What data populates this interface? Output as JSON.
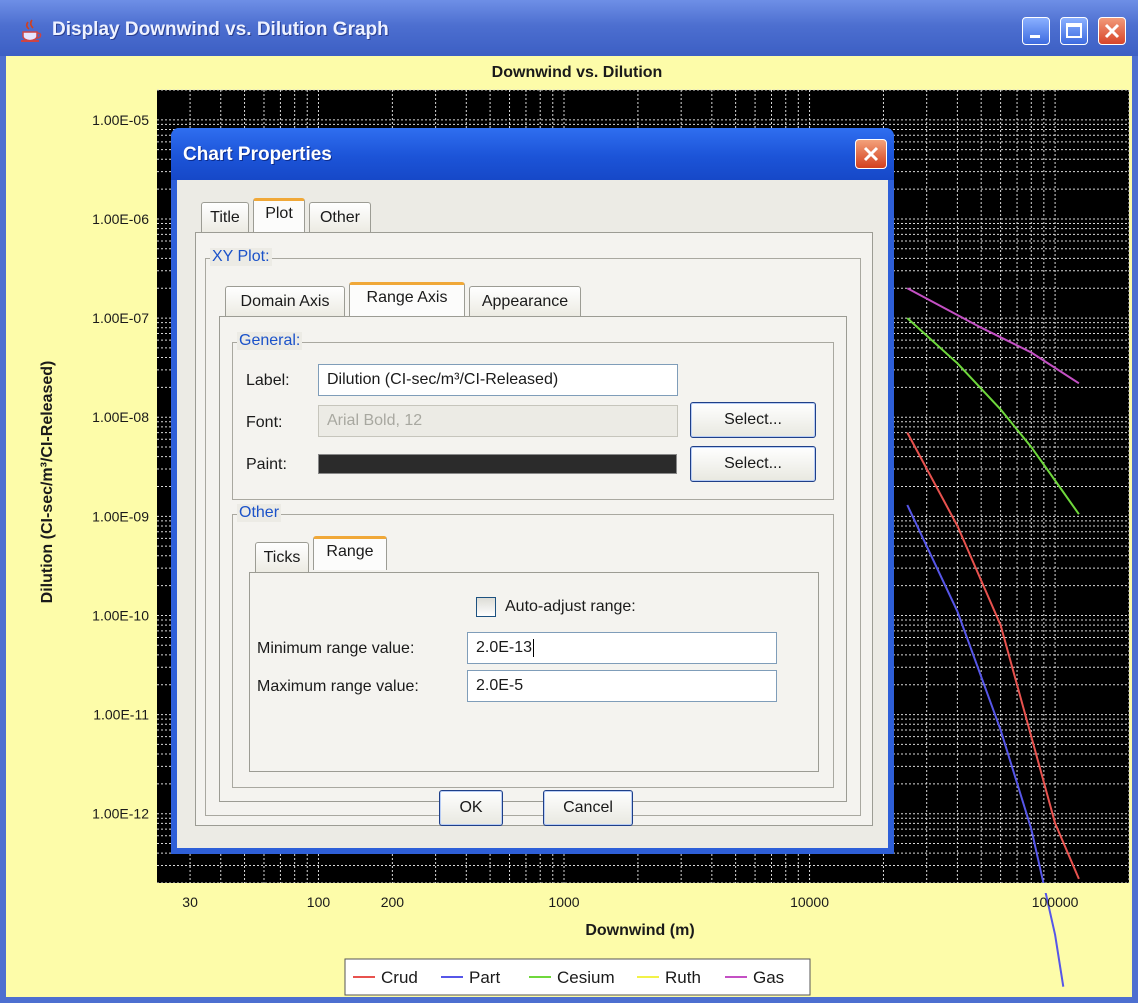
{
  "window": {
    "title": "Display Downwind vs. Dilution Graph",
    "icon": "java-cup-icon"
  },
  "chart_data": {
    "type": "line",
    "title": "Downwind vs. Dilution",
    "xlabel": "Downwind (m)",
    "ylabel": "Dilution (CI-sec/m³/CI-Released)",
    "xscale": "log",
    "yscale": "log",
    "xlim": [
      22,
      200000
    ],
    "ylim": [
      2e-13,
      2e-05
    ],
    "x_tick_labels": [
      "30",
      "100",
      "200",
      "1000",
      "10000",
      "100000"
    ],
    "x_ticks": [
      30,
      100,
      200,
      1000,
      10000,
      100000
    ],
    "y_tick_labels": [
      "1.00E-05",
      "1.00E-06",
      "1.00E-07",
      "1.00E-08",
      "1.00E-09",
      "1.00E-10",
      "1.00E-11",
      "1.00E-12"
    ],
    "y_ticks": [
      1e-05,
      1e-06,
      1e-07,
      1e-08,
      1e-09,
      1e-10,
      1e-11,
      1e-12
    ],
    "grid": true,
    "background": "#000000",
    "legend_position": "bottom",
    "series": [
      {
        "name": "Crud",
        "color": "#e8524e",
        "x": [
          25000,
          40000,
          60000,
          80000,
          100000,
          125000
        ],
        "y": [
          7e-09,
          8e-10,
          8e-11,
          6e-12,
          8e-13,
          2.2e-13
        ]
      },
      {
        "name": "Part",
        "color": "#5656e8",
        "x": [
          25000,
          40000,
          60000,
          80000,
          100000,
          108000
        ],
        "y": [
          1.3e-09,
          1.1e-10,
          7e-12,
          7e-13,
          6e-14,
          1.8e-14
        ]
      },
      {
        "name": "Cesium",
        "color": "#6fd83c",
        "x": [
          25000,
          40000,
          60000,
          80000,
          100000,
          125000
        ],
        "y": [
          1e-07,
          3.5e-08,
          1.2e-08,
          5e-09,
          2.3e-09,
          1.05e-09
        ]
      },
      {
        "name": "Ruth",
        "color": "#f2f248",
        "x": [],
        "y": []
      },
      {
        "name": "Gas",
        "color": "#c450c4",
        "x": [
          25000,
          50000,
          80000,
          125000
        ],
        "y": [
          2e-07,
          8e-08,
          4.5e-08,
          2.2e-08
        ]
      }
    ]
  },
  "dialog": {
    "title": "Chart Properties",
    "tabs": [
      "Title",
      "Plot",
      "Other"
    ],
    "selected_tab": "Plot",
    "xy_plot_label": "XY Plot:",
    "axis_tabs": [
      "Domain Axis",
      "Range Axis",
      "Appearance"
    ],
    "selected_axis_tab": "Range Axis",
    "general": {
      "legend": "General:",
      "label_caption": "Label:",
      "label_value": "Dilution (CI-sec/m³/CI-Released)",
      "font_caption": "Font:",
      "font_value": "Arial Bold, 12",
      "font_button": "Select...",
      "paint_caption": "Paint:",
      "paint_color": "#2b2b2b",
      "paint_button": "Select..."
    },
    "other": {
      "legend": "Other",
      "tabs": [
        "Ticks",
        "Range"
      ],
      "selected_tab": "Range",
      "auto_adjust_label": "Auto-adjust range:",
      "auto_adjust_checked": false,
      "min_caption": "Minimum range value:",
      "min_value": "2.0E-13",
      "max_caption": "Maximum range value:",
      "max_value": "2.0E-5"
    },
    "ok_label": "OK",
    "cancel_label": "Cancel"
  }
}
